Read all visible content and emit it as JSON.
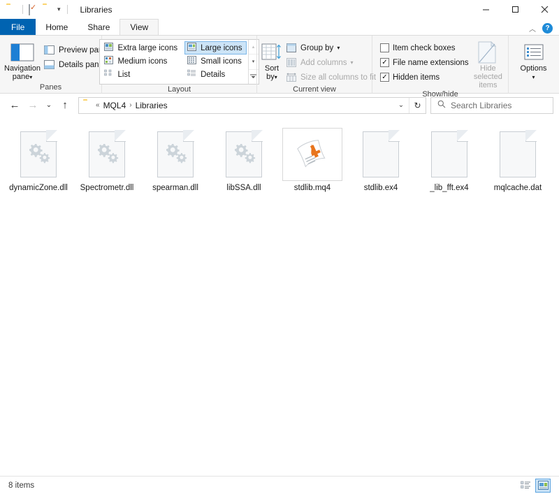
{
  "window": {
    "title": "Libraries",
    "quick_access": [
      {
        "name": "folder-icon",
        "label": "Properties"
      },
      {
        "name": "properties-icon",
        "label": "Properties"
      },
      {
        "name": "new-folder-icon",
        "label": "New folder"
      },
      {
        "name": "customize-caret",
        "label": "▾"
      }
    ],
    "controls": {
      "minimize": "–",
      "maximize": "▢",
      "close": "✕"
    }
  },
  "tabs": [
    {
      "label": "File",
      "id": "file"
    },
    {
      "label": "Home",
      "id": "home"
    },
    {
      "label": "Share",
      "id": "share"
    },
    {
      "label": "View",
      "id": "view"
    }
  ],
  "tabstrip_right": {
    "collapse": "︿",
    "help": "?"
  },
  "ribbon": {
    "groups": [
      {
        "label": "Panes",
        "big_button": {
          "label_line1": "Navigation",
          "label_line2": "pane",
          "caret": "▾"
        },
        "items": [
          {
            "label": "Preview pane",
            "disabled": false
          },
          {
            "label": "Details pane",
            "disabled": false
          }
        ]
      },
      {
        "label": "Layout",
        "gallery": [
          {
            "label": "Extra large icons",
            "selected": false
          },
          {
            "label": "Large icons",
            "selected": true
          },
          {
            "label": "Medium icons",
            "selected": false
          },
          {
            "label": "Small icons",
            "selected": false
          },
          {
            "label": "List",
            "selected": false
          },
          {
            "label": "Details",
            "selected": false
          }
        ],
        "scroll": {
          "up": "▴",
          "down": "▾",
          "more": "▾"
        }
      },
      {
        "label": "Current view",
        "big_button": {
          "label_line1": "Sort",
          "label_line2": "by",
          "caret": "▾"
        },
        "items": [
          {
            "label": "Group by",
            "caret": "▾",
            "disabled": false
          },
          {
            "label": "Add columns",
            "caret": "▾",
            "disabled": true
          },
          {
            "label": "Size all columns to fit",
            "disabled": true
          }
        ]
      },
      {
        "label": "Show/hide",
        "checkboxes": [
          {
            "label": "Item check boxes",
            "checked": false
          },
          {
            "label": "File name extensions",
            "checked": true
          },
          {
            "label": "Hidden items",
            "checked": true
          }
        ],
        "big_button": {
          "label_line1": "Hide selected",
          "label_line2": "items",
          "disabled": true
        }
      },
      {
        "label": "",
        "options_button": {
          "label": "Options",
          "caret": "▾"
        }
      }
    ]
  },
  "addressbar": {
    "back": "←",
    "forward": "→",
    "recent": "⌄",
    "up": "↑",
    "crumbs": [
      "«",
      "MQL4",
      "Libraries"
    ],
    "separator": "›",
    "dropdown": "⌄",
    "refresh": "↻"
  },
  "search": {
    "icon": "search-icon",
    "placeholder": "Search Libraries",
    "value": ""
  },
  "files": [
    {
      "name": "dynamicZone.dll",
      "icon": "dll-gears-icon",
      "selected": false
    },
    {
      "name": "Spectrometr.dll",
      "icon": "dll-gears-icon",
      "selected": false
    },
    {
      "name": "spearman.dll",
      "icon": "dll-gears-icon",
      "selected": false
    },
    {
      "name": "libSSA.dll",
      "icon": "dll-gears-icon",
      "selected": false
    },
    {
      "name": "stdlib.mq4",
      "icon": "mq4-metatrader-icon",
      "selected": true
    },
    {
      "name": "stdlib.ex4",
      "icon": "blank-page-icon",
      "selected": false
    },
    {
      "name": "_lib_fft.ex4",
      "icon": "blank-page-icon",
      "selected": false
    },
    {
      "name": "mqlcache.dat",
      "icon": "blank-page-icon",
      "selected": false
    }
  ],
  "statusbar": {
    "count_text": "8 items",
    "views": [
      {
        "name": "details-view-button",
        "active": false
      },
      {
        "name": "large-icons-view-button",
        "active": true
      }
    ]
  },
  "colors": {
    "accent": "#0063b1",
    "selection": "#cce4f7",
    "ribbon_bg": "#f6f6f6",
    "folder_yellow": "#fbd46d",
    "mq4_orange": "#e8741c"
  }
}
